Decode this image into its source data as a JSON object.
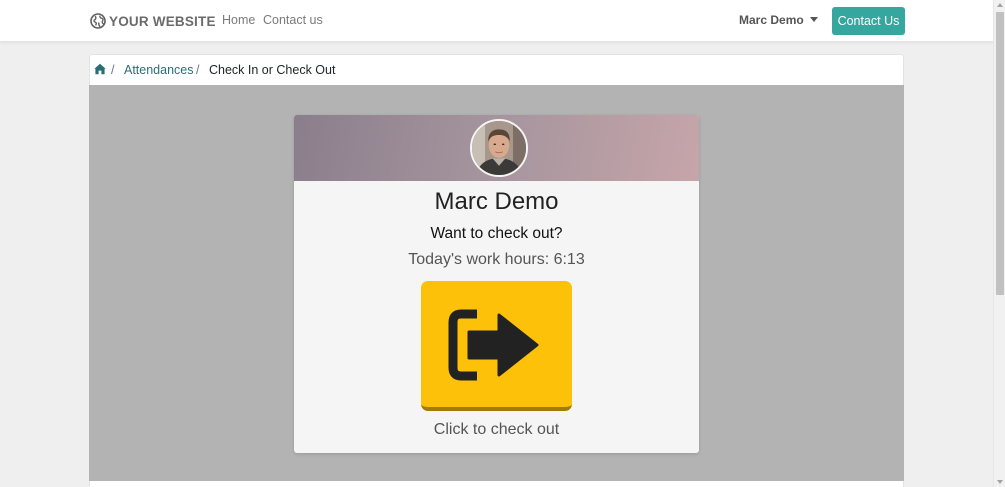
{
  "navbar": {
    "logo_text": "YOUR WEBSITE",
    "logo_icon": "globe-icon",
    "links": {
      "home": "Home",
      "contact": "Contact us"
    },
    "user_name": "Marc Demo",
    "cta_label": "Contact Us",
    "cta_color": "#35a79e"
  },
  "breadcrumb": {
    "home_icon": "home-icon",
    "separator": "/",
    "items": [
      "Attendances",
      "Check In or Check Out"
    ]
  },
  "card": {
    "employee_name": "Marc Demo",
    "question": "Want to check out?",
    "work_hours": "Today's work hours: 6:13",
    "button_icon": "sign-out-icon",
    "button_color": "#fdc10a",
    "button_caption": "Click to check out"
  }
}
